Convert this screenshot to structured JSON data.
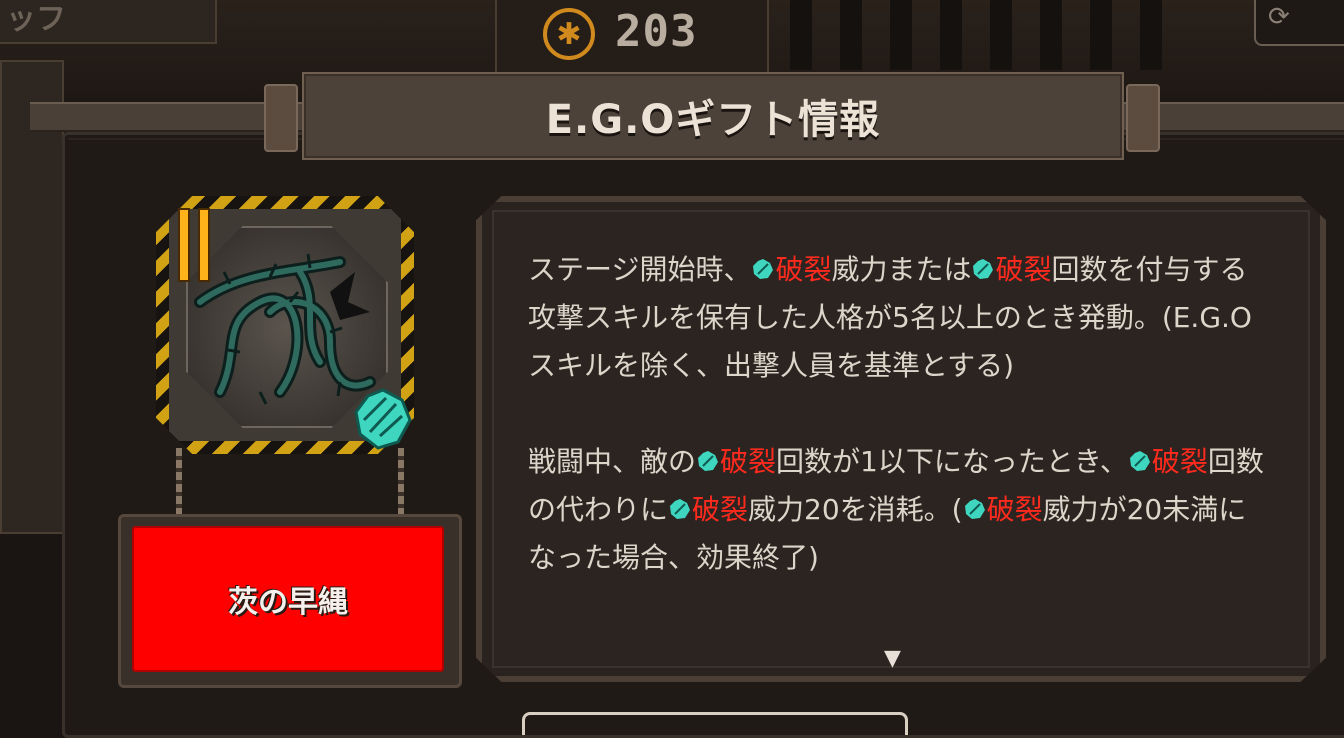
{
  "top_bar": {
    "left_tab_text": "ッフ",
    "currency": {
      "icon": "gear-coin-icon",
      "amount": "203"
    },
    "right_icon": "refresh-icon"
  },
  "dialog": {
    "title": "E.G.Oギフト情報",
    "gift": {
      "tier": "II",
      "icon": "thorn-vine-icon",
      "element_icon": "rupture-leaf-icon",
      "name": "茨の早縄",
      "button_color": "#ff0000"
    },
    "description": {
      "keyword_color": "#ff2a1e",
      "keyword": "破裂",
      "p1": {
        "a": "ステージ開始時、",
        "b": "威力または",
        "c": "回数を付与する攻撃スキルを保有した人格が5名以上のとき発動。(E.G.Oスキルを除く、出撃人員を基準とする)"
      },
      "p2": {
        "a": "戦闘中、敵の",
        "b": "回数が1以下になったとき、",
        "c": "回数の代わりに",
        "d": "威力20を消耗。(",
        "e": "威力が20未満になった場合、効果終了)"
      },
      "scroll_indicator": "▼"
    }
  }
}
